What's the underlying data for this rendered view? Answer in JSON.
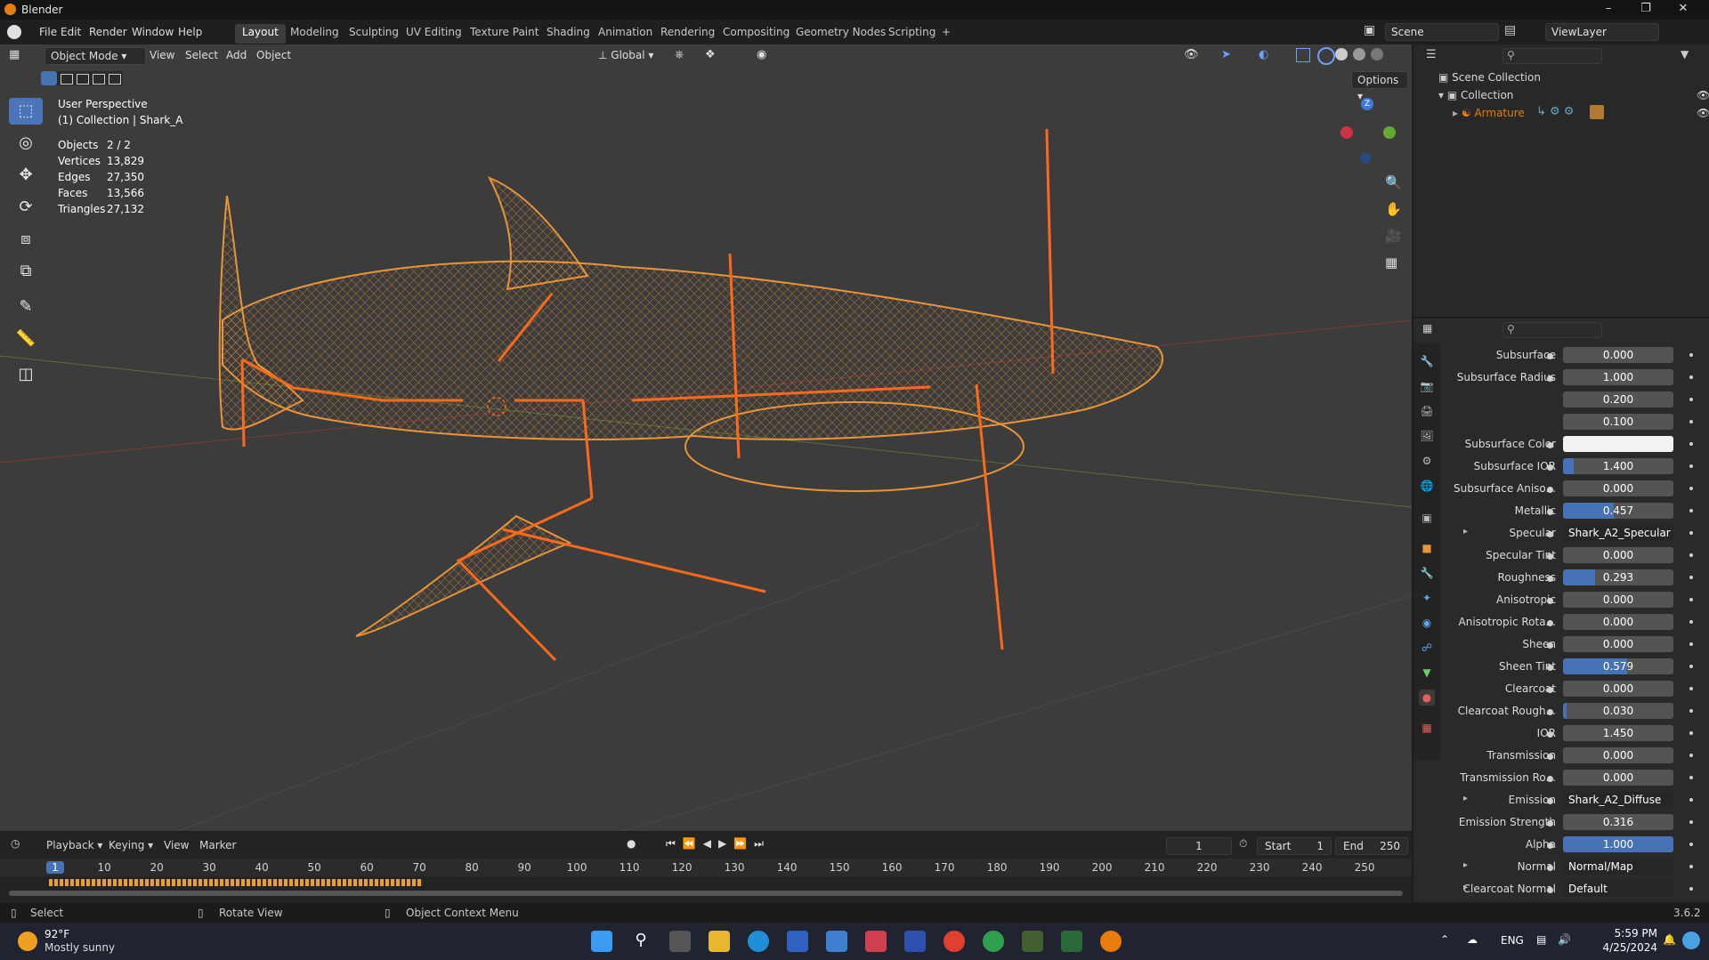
{
  "app": {
    "title": "Blender",
    "version": "3.6.2"
  },
  "menus": [
    "File",
    "Edit",
    "Render",
    "Window",
    "Help"
  ],
  "workspaces": [
    "Layout",
    "Modeling",
    "Sculpting",
    "UV Editing",
    "Texture Paint",
    "Shading",
    "Animation",
    "Rendering",
    "Compositing",
    "Geometry Nodes",
    "Scripting"
  ],
  "active_workspace": "Layout",
  "scene_name": "Scene",
  "view_layer": "ViewLayer",
  "viewport": {
    "mode": "Object Mode",
    "menus": [
      "View",
      "Select",
      "Add",
      "Object"
    ],
    "orientation": "Global",
    "options_label": "Options",
    "perspective": "User Perspective",
    "collection_info": "(1) Collection | Shark_A",
    "stats": [
      {
        "label": "Objects",
        "value": "2 / 2"
      },
      {
        "label": "Vertices",
        "value": "13,829"
      },
      {
        "label": "Edges",
        "value": "27,350"
      },
      {
        "label": "Faces",
        "value": "13,566"
      },
      {
        "label": "Triangles",
        "value": "27,132"
      }
    ],
    "gizmo_axis_z": "Z"
  },
  "outliner": {
    "items": [
      {
        "label": "Scene Collection"
      },
      {
        "label": "Collection"
      },
      {
        "label": "Armature"
      }
    ]
  },
  "properties": {
    "rows": [
      {
        "label": "Subsurface",
        "value": "0.000",
        "fill": 0
      },
      {
        "label": "Subsurface Radius",
        "value": "1.000",
        "fill": 0
      },
      {
        "label": "",
        "value": "0.200",
        "fill": 0
      },
      {
        "label": "",
        "value": "0.100",
        "fill": 0
      },
      {
        "label": "Subsurface Color",
        "value": "",
        "fill": 0,
        "color": "#f2f2f2"
      },
      {
        "label": "Subsurface IOR",
        "value": "1.400",
        "fill": 0.1
      },
      {
        "label": "Subsurface Aniso...",
        "value": "0.000",
        "fill": 0
      },
      {
        "label": "Metallic",
        "value": "0.457",
        "fill": 0.457
      },
      {
        "label": "Specular",
        "value": "Shark_A2_Specular",
        "link": true
      },
      {
        "label": "Specular Tint",
        "value": "0.000",
        "fill": 0
      },
      {
        "label": "Roughness",
        "value": "0.293",
        "fill": 0.293
      },
      {
        "label": "Anisotropic",
        "value": "0.000",
        "fill": 0
      },
      {
        "label": "Anisotropic Rota...",
        "value": "0.000",
        "fill": 0
      },
      {
        "label": "Sheen",
        "value": "0.000",
        "fill": 0
      },
      {
        "label": "Sheen Tint",
        "value": "0.579",
        "fill": 0.579
      },
      {
        "label": "Clearcoat",
        "value": "0.000",
        "fill": 0
      },
      {
        "label": "Clearcoat Rough...",
        "value": "0.030",
        "fill": 0.03
      },
      {
        "label": "IOR",
        "value": "1.450",
        "fill": 0
      },
      {
        "label": "Transmission",
        "value": "0.000",
        "fill": 0
      },
      {
        "label": "Transmission Ro...",
        "value": "0.000",
        "fill": 0
      },
      {
        "label": "Emission",
        "value": "Shark_A2_Diffuse",
        "link": true
      },
      {
        "label": "Emission Strength",
        "value": "0.316",
        "fill": 0
      },
      {
        "label": "Alpha",
        "value": "1.000",
        "fill": 1
      },
      {
        "label": "Normal",
        "value": "Normal/Map",
        "link": true
      },
      {
        "label": "Clearcoat Normal",
        "value": "Default",
        "link": true
      }
    ]
  },
  "timeline": {
    "menus": [
      "Playback",
      "Keying",
      "View",
      "Marker"
    ],
    "current_frame": "1",
    "start_label": "Start",
    "start": "1",
    "end_label": "End",
    "end": "250",
    "ruler": [
      "1",
      "10",
      "20",
      "30",
      "40",
      "50",
      "60",
      "70",
      "80",
      "90",
      "100",
      "110",
      "120",
      "130",
      "140",
      "150",
      "160",
      "170",
      "180",
      "190",
      "200",
      "210",
      "220",
      "230",
      "240",
      "250"
    ]
  },
  "statusbar": {
    "select": "Select",
    "rotate": "Rotate View",
    "context": "Object Context Menu"
  },
  "taskbar": {
    "weather_temp": "92°F",
    "weather_desc": "Mostly sunny",
    "lang": "ENG",
    "time": "5:59 PM",
    "date": "4/25/2024"
  },
  "colors": {
    "accent": "#4772b3",
    "wire": "#e8953a",
    "bone": "#ff6a1a",
    "active": "#e87d0d"
  }
}
